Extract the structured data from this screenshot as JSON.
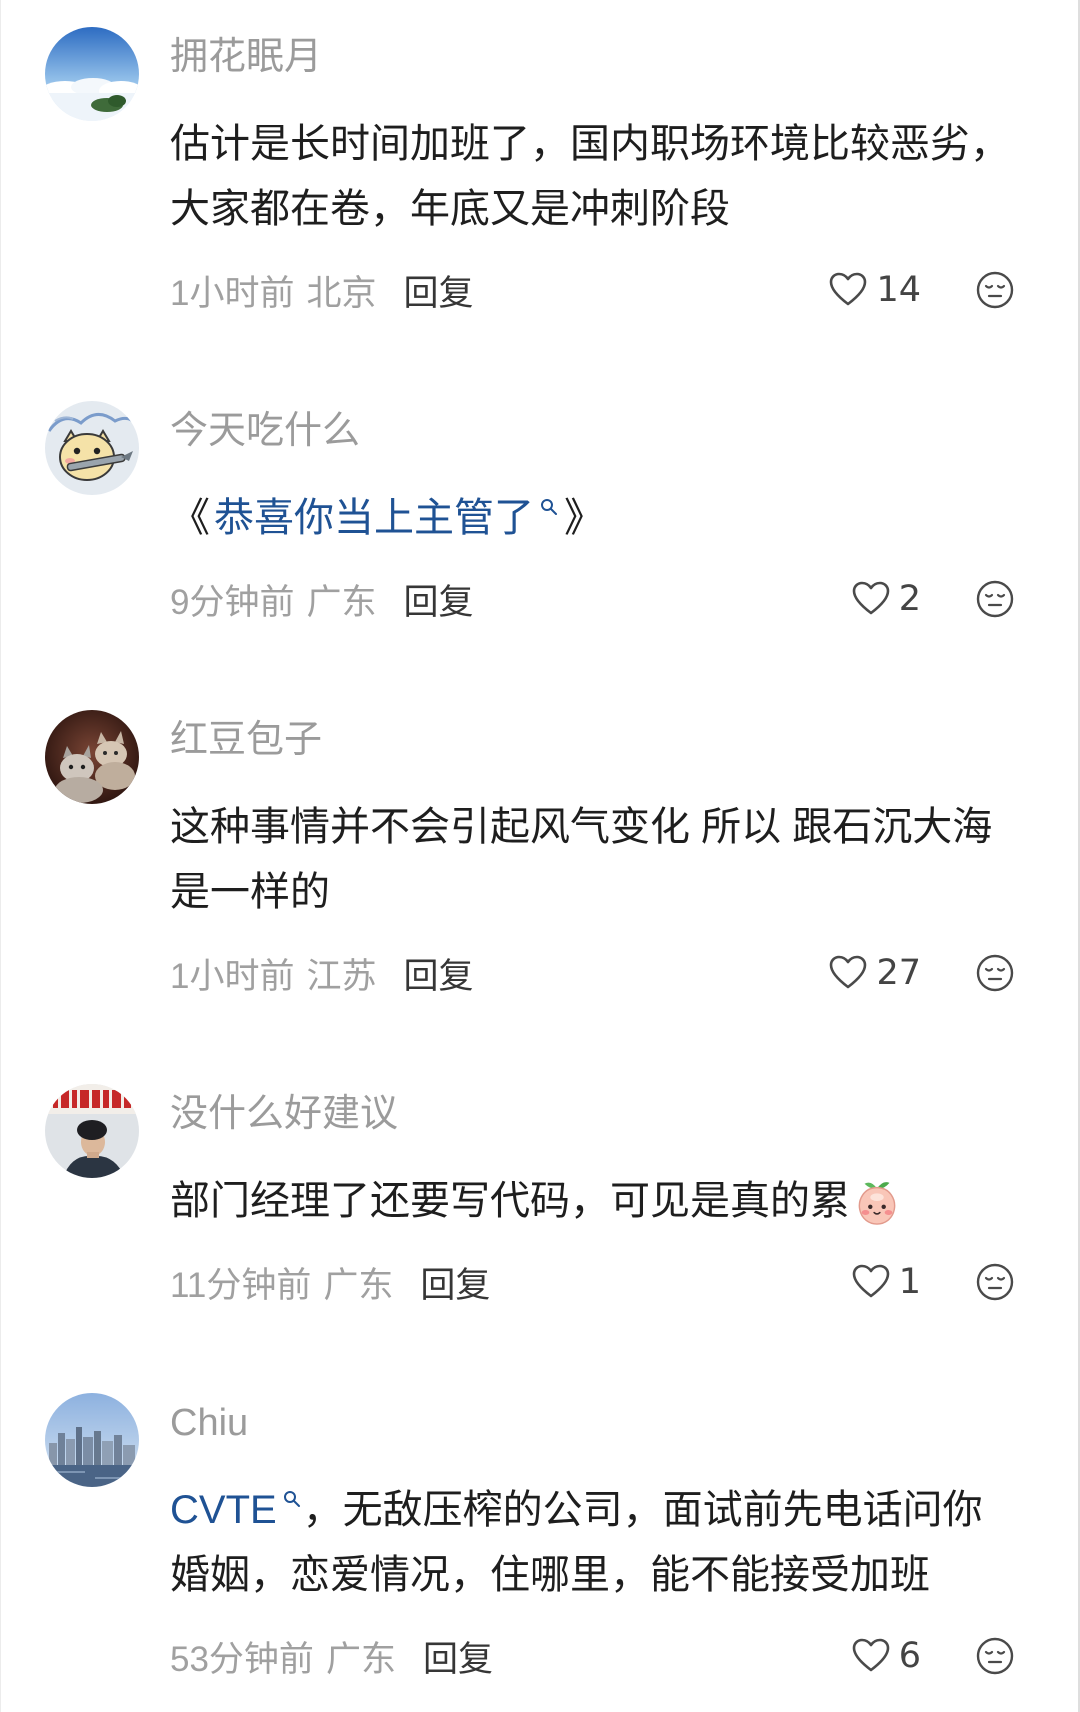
{
  "comments": [
    {
      "username": "拥花眠月",
      "lines": [
        [
          "估计是长时间加班了，国内职场环境比较恶劣，"
        ],
        [
          "大家都在卷，年底又是冲刺阶段"
        ]
      ],
      "time": "1小时前",
      "location": "北京",
      "reply_label": "回复",
      "likes": "14"
    },
    {
      "username": "今天吃什么",
      "lines": [
        [
          "《",
          "恭喜你当上主管了",
          "》"
        ]
      ],
      "time": "9分钟前",
      "location": "广东",
      "reply_label": "回复",
      "likes": "2"
    },
    {
      "username": "红豆包子",
      "lines": [
        [
          "这种事情并不会引起风气变化 所以 跟石沉大海"
        ],
        [
          "是一样的"
        ]
      ],
      "time": "1小时前",
      "location": "江苏",
      "reply_label": "回复",
      "likes": "27"
    },
    {
      "username": "没什么好建议",
      "lines": [
        [
          "部门经理了还要写代码，可见是真的累"
        ]
      ],
      "emoji": "peach-face-emoji",
      "time": "11分钟前",
      "location": "广东",
      "reply_label": "回复",
      "likes": "1"
    },
    {
      "username": "Chiu",
      "lines": [
        [
          "CVTE",
          "，无敌压榨的公司，面试前先电话问你"
        ],
        [
          "婚姻，恋爱情况，住哪里，能不能接受加班"
        ]
      ],
      "time": "53分钟前",
      "location": "广东",
      "reply_label": "回复",
      "likes": "6"
    }
  ],
  "icons": {
    "like": "heart-outline-icon",
    "dislike": "neutral-face-icon",
    "topic_link": "search-icon"
  },
  "colors": {
    "link": "#1f5294",
    "username": "#9b9b9b",
    "text": "#1e1e1e",
    "meta": "#a0a0a0",
    "reply": "#363636",
    "icon": "#4a4a4a"
  }
}
